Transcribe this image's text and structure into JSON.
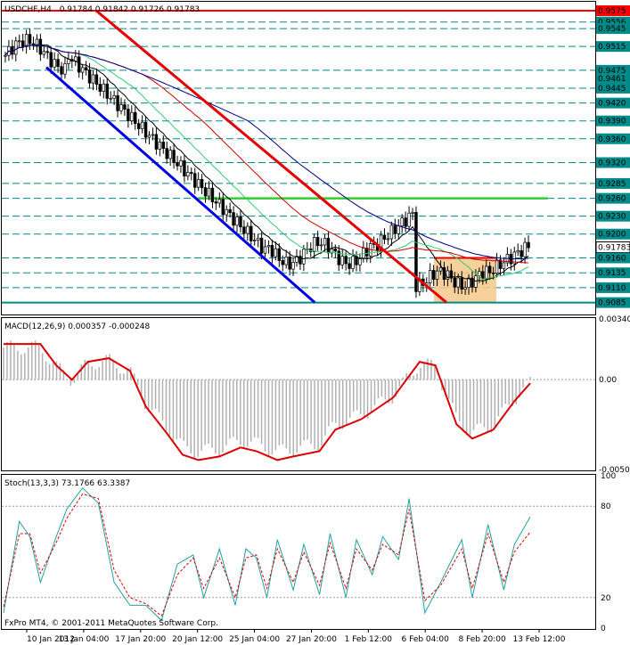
{
  "chart_data": [
    {
      "type": "candlestick",
      "panel": "price",
      "symbol": "USDCHF,H4",
      "ohlc_text": "0.91784 0.91842 0.91726 0.91783",
      "ylim": [
        0.9065,
        0.959
      ],
      "x_ticks": [
        "10 Jan 2012",
        "13 Jan 04:00",
        "17 Jan 20:00",
        "20 Jan 12:00",
        "25 Jan 04:00",
        "27 Jan 20:00",
        "1 Feb 12:00",
        "6 Feb 04:00",
        "8 Feb 20:00",
        "13 Feb 12:00"
      ],
      "y_labels": [
        "0.9575",
        "0.9556",
        "0.9545",
        "0.9515",
        "0.9475",
        "0.9461",
        "0.9445",
        "0.9420",
        "0.9390",
        "0.9360",
        "0.9320",
        "0.9285",
        "0.9260",
        "0.9230",
        "0.9200",
        "0.9178",
        "0.9160",
        "0.9135",
        "0.9110",
        "0.9085"
      ],
      "current_price": "0.91783",
      "levels": {
        "resistance": 0.9575,
        "breakout_level": 0.926,
        "support": 0.9085,
        "dashed": [
          0.9556,
          0.9545,
          0.9515,
          0.9475,
          0.9445,
          0.942,
          0.939,
          0.936,
          0.932,
          0.9285,
          0.926,
          0.923,
          0.92,
          0.916,
          0.9135,
          0.911
        ]
      },
      "trend_channel_red": [
        [
          "10 Jan 2012",
          0.9575
        ],
        [
          "8 Feb 20:00",
          0.9085
        ]
      ],
      "trend_channel_blue": [
        [
          "10 Jan 2012",
          0.948
        ],
        [
          "1 Feb 12:00",
          0.9085
        ]
      ],
      "consolidation_box": {
        "top": 0.916,
        "bottom": 0.9085
      },
      "moving_averages": [
        "black",
        "green",
        "red",
        "blue"
      ],
      "colors": {
        "resistance": "#ff0000",
        "breakout": "#33cc33",
        "support": "#008b8b",
        "channel_red": "#e60000",
        "channel_blue": "#0000e6",
        "box": "#f5c98a",
        "ma_black": "#000000",
        "ma_green": "#2ecc71",
        "ma_red": "#cc0000",
        "ma_blue": "#000088"
      }
    },
    {
      "type": "histogram+line",
      "panel": "macd",
      "title": "MACD(12,26,9) 0.000357 -0.000248",
      "y_labels": [
        "0.00340",
        "0.00",
        "-0.00503"
      ],
      "ylim": [
        -0.00503,
        0.0034
      ],
      "signal_points": [
        [
          0,
          0.002
        ],
        [
          0.03,
          0.002
        ],
        [
          0.07,
          0.002
        ],
        [
          0.1,
          0.0008
        ],
        [
          0.13,
          0.0
        ],
        [
          0.16,
          0.001
        ],
        [
          0.2,
          0.0012
        ],
        [
          0.24,
          0.0005
        ],
        [
          0.27,
          -0.0015
        ],
        [
          0.31,
          -0.003
        ],
        [
          0.34,
          -0.0042
        ],
        [
          0.37,
          -0.0045
        ],
        [
          0.41,
          -0.0043
        ],
        [
          0.45,
          -0.0038
        ],
        [
          0.48,
          -0.004
        ],
        [
          0.52,
          -0.0045
        ],
        [
          0.55,
          -0.0043
        ],
        [
          0.6,
          -0.004
        ],
        [
          0.63,
          -0.0028
        ],
        [
          0.68,
          -0.0022
        ],
        [
          0.74,
          -0.001
        ],
        [
          0.79,
          0.001
        ],
        [
          0.82,
          0.0008
        ],
        [
          0.86,
          -0.0025
        ],
        [
          0.89,
          -0.0033
        ],
        [
          0.93,
          -0.0028
        ],
        [
          0.97,
          -0.0012
        ],
        [
          1.0,
          -0.0002
        ]
      ]
    },
    {
      "type": "line",
      "panel": "stochastic",
      "title": "Stoch(13,3,3) 73.1766 63.3387",
      "y_labels": [
        "100",
        "80",
        "20",
        "0"
      ],
      "ylim": [
        0,
        100
      ],
      "main_points": [
        [
          0,
          10
        ],
        [
          0.03,
          70
        ],
        [
          0.05,
          60
        ],
        [
          0.07,
          30
        ],
        [
          0.1,
          60
        ],
        [
          0.12,
          78
        ],
        [
          0.15,
          92
        ],
        [
          0.18,
          82
        ],
        [
          0.21,
          30
        ],
        [
          0.24,
          15
        ],
        [
          0.27,
          15
        ],
        [
          0.3,
          5
        ],
        [
          0.33,
          42
        ],
        [
          0.36,
          48
        ],
        [
          0.38,
          20
        ],
        [
          0.41,
          52
        ],
        [
          0.44,
          15
        ],
        [
          0.46,
          52
        ],
        [
          0.48,
          46
        ],
        [
          0.5,
          20
        ],
        [
          0.52,
          58
        ],
        [
          0.55,
          25
        ],
        [
          0.57,
          55
        ],
        [
          0.6,
          22
        ],
        [
          0.62,
          62
        ],
        [
          0.65,
          20
        ],
        [
          0.67,
          58
        ],
        [
          0.7,
          35
        ],
        [
          0.72,
          60
        ],
        [
          0.75,
          45
        ],
        [
          0.77,
          85
        ],
        [
          0.8,
          10
        ],
        [
          0.83,
          30
        ],
        [
          0.87,
          58
        ],
        [
          0.89,
          20
        ],
        [
          0.92,
          68
        ],
        [
          0.95,
          25
        ],
        [
          0.97,
          55
        ],
        [
          1.0,
          73
        ]
      ],
      "signal_points": [
        [
          0,
          14
        ],
        [
          0.03,
          62
        ],
        [
          0.05,
          62
        ],
        [
          0.07,
          36
        ],
        [
          0.1,
          56
        ],
        [
          0.12,
          72
        ],
        [
          0.15,
          88
        ],
        [
          0.18,
          85
        ],
        [
          0.21,
          38
        ],
        [
          0.24,
          20
        ],
        [
          0.27,
          16
        ],
        [
          0.3,
          8
        ],
        [
          0.33,
          35
        ],
        [
          0.36,
          46
        ],
        [
          0.38,
          26
        ],
        [
          0.41,
          46
        ],
        [
          0.44,
          20
        ],
        [
          0.46,
          46
        ],
        [
          0.48,
          48
        ],
        [
          0.5,
          26
        ],
        [
          0.52,
          52
        ],
        [
          0.55,
          30
        ],
        [
          0.57,
          50
        ],
        [
          0.6,
          28
        ],
        [
          0.62,
          56
        ],
        [
          0.65,
          26
        ],
        [
          0.67,
          52
        ],
        [
          0.7,
          38
        ],
        [
          0.72,
          55
        ],
        [
          0.75,
          48
        ],
        [
          0.77,
          78
        ],
        [
          0.8,
          18
        ],
        [
          0.83,
          28
        ],
        [
          0.87,
          52
        ],
        [
          0.89,
          26
        ],
        [
          0.92,
          62
        ],
        [
          0.95,
          30
        ],
        [
          0.97,
          50
        ],
        [
          1.0,
          63
        ]
      ]
    }
  ],
  "footer": {
    "copyright": "FxPro MT4, © 2001-2011 MetaQuotes Software Corp."
  }
}
